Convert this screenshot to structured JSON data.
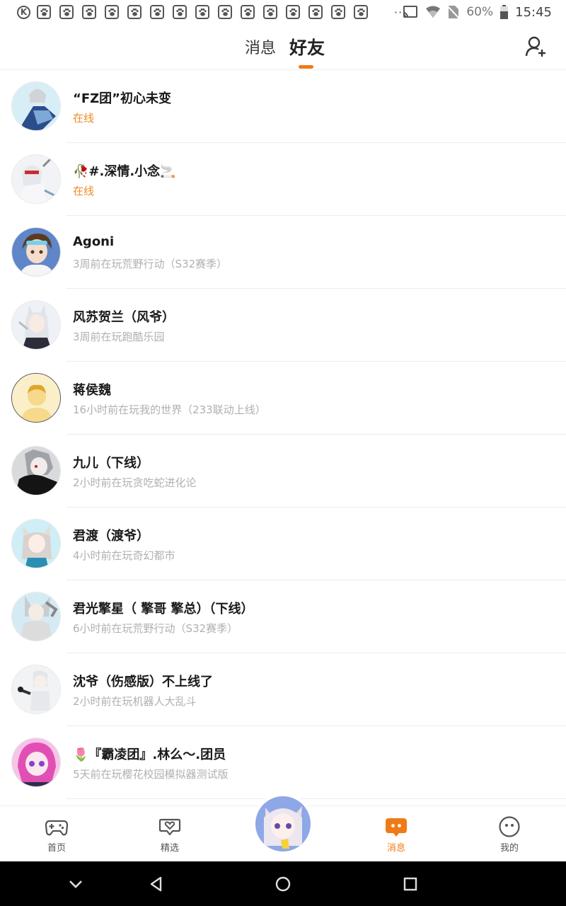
{
  "status_bar": {
    "left_icons": [
      "k-badge-icon",
      "paw-icon",
      "paw-icon",
      "paw-icon",
      "paw-icon",
      "paw-icon",
      "paw-icon",
      "paw-icon",
      "paw-icon",
      "paw-icon",
      "paw-icon",
      "paw-icon",
      "paw-icon",
      "paw-icon",
      "paw-icon",
      "paw-icon"
    ],
    "overflow": "···",
    "battery_percent": "60%",
    "time": "15:45"
  },
  "header": {
    "tabs": [
      {
        "label": "消息",
        "active": false
      },
      {
        "label": "好友",
        "active": true
      }
    ],
    "accent_color": "#f07a16"
  },
  "friends": [
    {
      "name": "“FZ团”初心未变",
      "status": "在线",
      "online": true,
      "avatar": "avatar-anime-blue-white"
    },
    {
      "name": "🥀#.深情.小念🚬",
      "status": "在线",
      "online": true,
      "avatar": "avatar-anime-white-red"
    },
    {
      "name": "Agoni",
      "status": "3周前在玩荒野行动（S32赛季）",
      "online": false,
      "avatar": "avatar-anime-boy-brown"
    },
    {
      "name": "风苏贺兰（风爷）",
      "status": "3周前在玩跑酷乐园",
      "online": false,
      "avatar": "avatar-anime-catgirl-silver"
    },
    {
      "name": "蒋侯魏",
      "status": "16小时前在玩我的世界（233联动上线）",
      "online": false,
      "avatar": "avatar-default-yellow"
    },
    {
      "name": "九儿（下线）",
      "status": "2小时前在玩贪吃蛇进化论",
      "online": false,
      "avatar": "avatar-anime-dark"
    },
    {
      "name": "君渡（渡爷）",
      "status": "4小时前在玩奇幻都市",
      "online": false,
      "avatar": "avatar-anime-foxgirl-teal"
    },
    {
      "name": "君光擎星（ 擎哥 擎总）（下线）",
      "status": "6小时前在玩荒野行动（S32赛季）",
      "online": false,
      "avatar": "avatar-anime-silver-suit"
    },
    {
      "name": "沈爷（伤感版）不上线了",
      "status": "2小时前在玩机器人大乱斗",
      "online": false,
      "avatar": "avatar-anime-white-hair"
    },
    {
      "name": "🌷『霸凌团』.林么〜.团员",
      "status": "5天前在玩樱花校园模拟器测试版",
      "online": false,
      "avatar": "avatar-anime-pink"
    }
  ],
  "bottom_nav": [
    {
      "label": "首页",
      "icon": "gamepad-icon",
      "active": false
    },
    {
      "label": "精选",
      "icon": "heart-bubble-icon",
      "active": false
    },
    {
      "label": "",
      "icon": "center-avatar",
      "active": false
    },
    {
      "label": "消息",
      "icon": "message-icon",
      "active": true
    },
    {
      "label": "我的",
      "icon": "face-icon",
      "active": false
    }
  ],
  "system_nav": [
    "collapse-icon",
    "back-icon",
    "home-icon",
    "recents-icon"
  ]
}
